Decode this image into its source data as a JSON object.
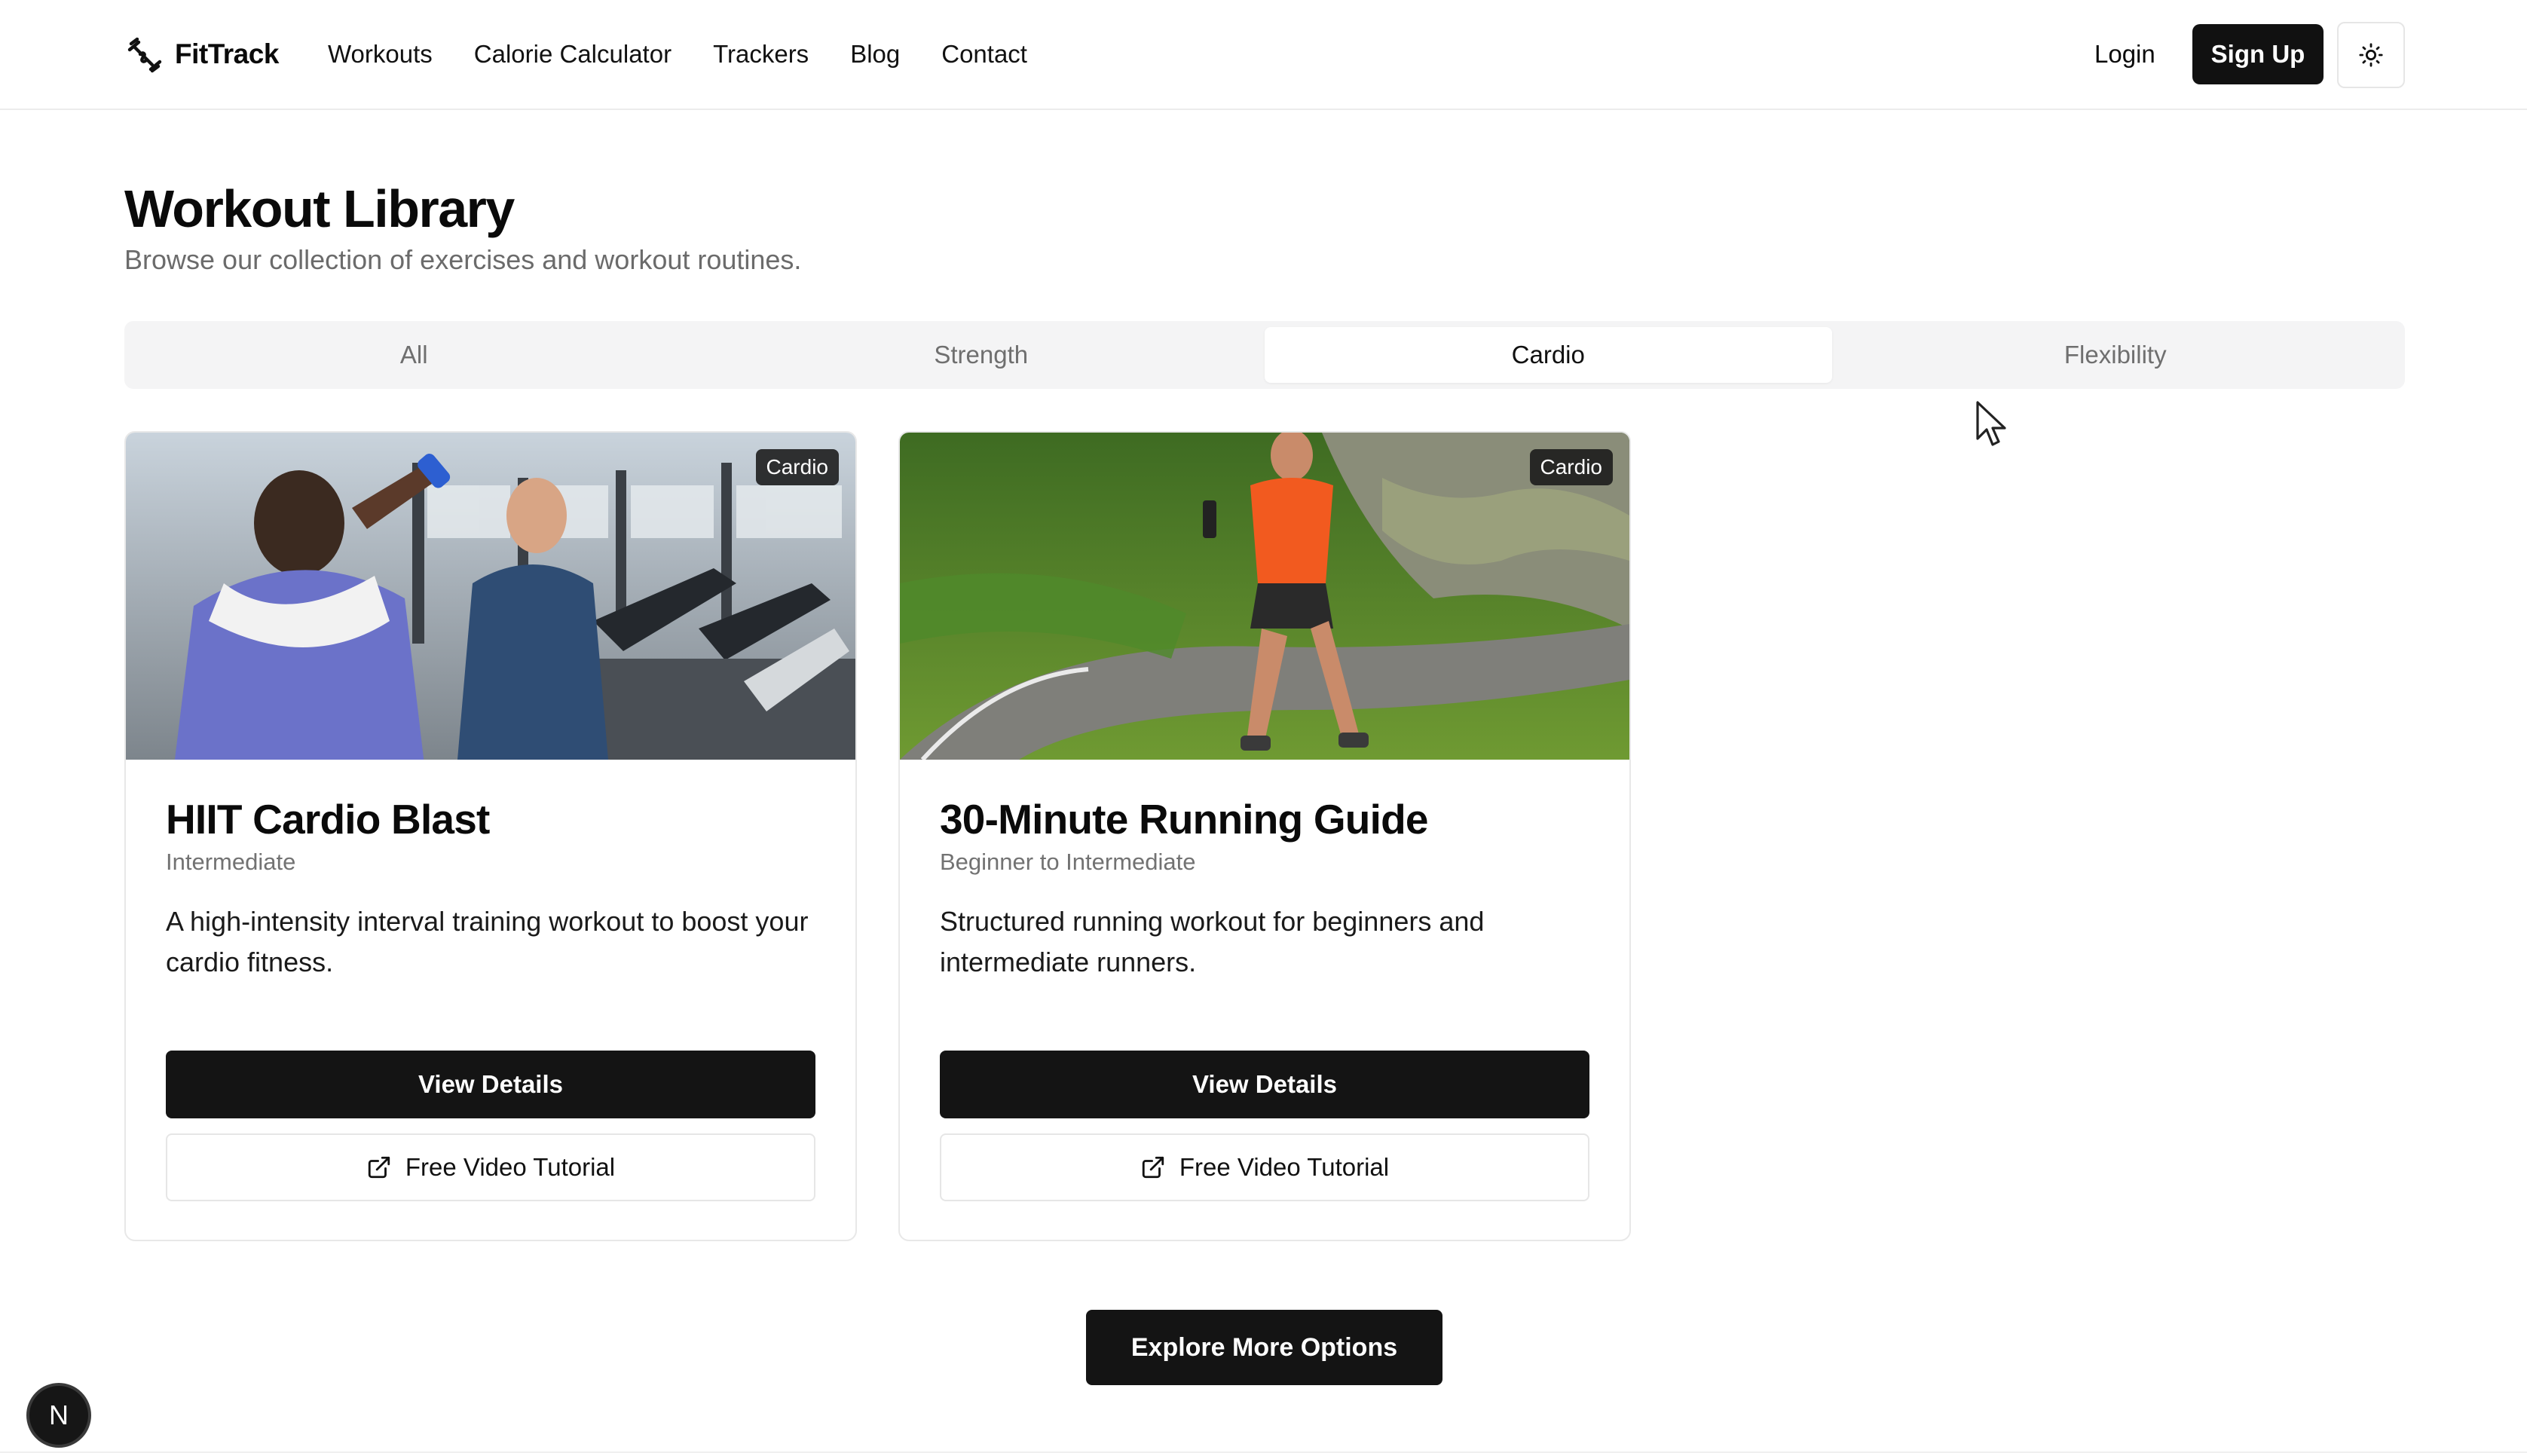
{
  "header": {
    "brand": "FitTrack",
    "nav": [
      "Workouts",
      "Calorie Calculator",
      "Trackers",
      "Blog",
      "Contact"
    ],
    "login": "Login",
    "signup": "Sign Up",
    "theme_icon": "sun-icon"
  },
  "page": {
    "title": "Workout Library",
    "subtitle": "Browse our collection of exercises and workout routines."
  },
  "tabs": {
    "items": [
      "All",
      "Strength",
      "Cardio",
      "Flexibility"
    ],
    "active": "Cardio"
  },
  "cards": [
    {
      "badge": "Cardio",
      "title": "HIIT Cardio Blast",
      "level": "Intermediate",
      "description": "A high-intensity interval training workout to boost your cardio fitness.",
      "primary_label": "View Details",
      "secondary_label": "Free Video Tutorial",
      "image": "gym-cardio-photo"
    },
    {
      "badge": "Cardio",
      "title": "30-Minute Running Guide",
      "level": "Beginner to Intermediate",
      "description": "Structured running workout for beginners and intermediate runners.",
      "primary_label": "View Details",
      "secondary_label": "Free Video Tutorial",
      "image": "road-running-photo"
    }
  ],
  "explore": "Explore More Options",
  "floating_badge": "N",
  "colors": {
    "primary": "#141414",
    "muted_text": "#6b6b6b",
    "tabs_bg": "#f4f4f5",
    "border": "#e8e8e8"
  }
}
